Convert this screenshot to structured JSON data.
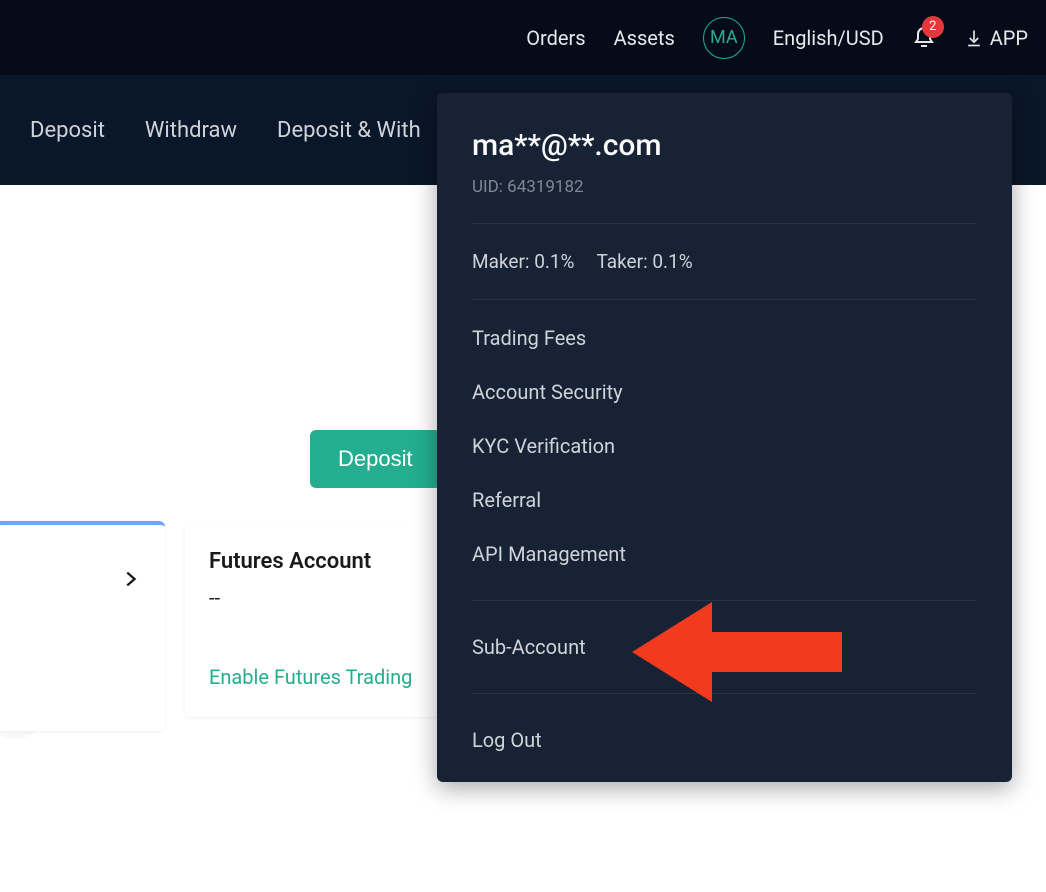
{
  "header": {
    "orders": "Orders",
    "assets": "Assets",
    "avatar_initials": "MA",
    "language_currency": "English/USD",
    "notification_count": "2",
    "app_label": "APP"
  },
  "subnav": {
    "deposit": "Deposit",
    "withdraw": "Withdraw",
    "deposit_withdraw_history": "Deposit & With"
  },
  "main": {
    "deposit_button": "Deposit",
    "card_partial": {
      "present": true
    },
    "futures_card": {
      "title": "Futures Account",
      "value": "--",
      "link": "Enable Futures Trading"
    }
  },
  "dropdown": {
    "email": "ma**@**.com",
    "uid_label": "UID: 64319182",
    "maker_label": "Maker: 0.1%",
    "taker_label": "Taker: 0.1%",
    "items": {
      "trading_fees": "Trading Fees",
      "account_security": "Account Security",
      "kyc": "KYC Verification",
      "referral": "Referral",
      "api_management": "API Management",
      "sub_account": "Sub-Account",
      "log_out": "Log Out"
    }
  },
  "colors": {
    "accent_green": "#24ae8f",
    "badge_red": "#e6383a",
    "panel_bg": "#172235",
    "header_bg": "#060b19",
    "subheader_bg": "#0a1629"
  }
}
